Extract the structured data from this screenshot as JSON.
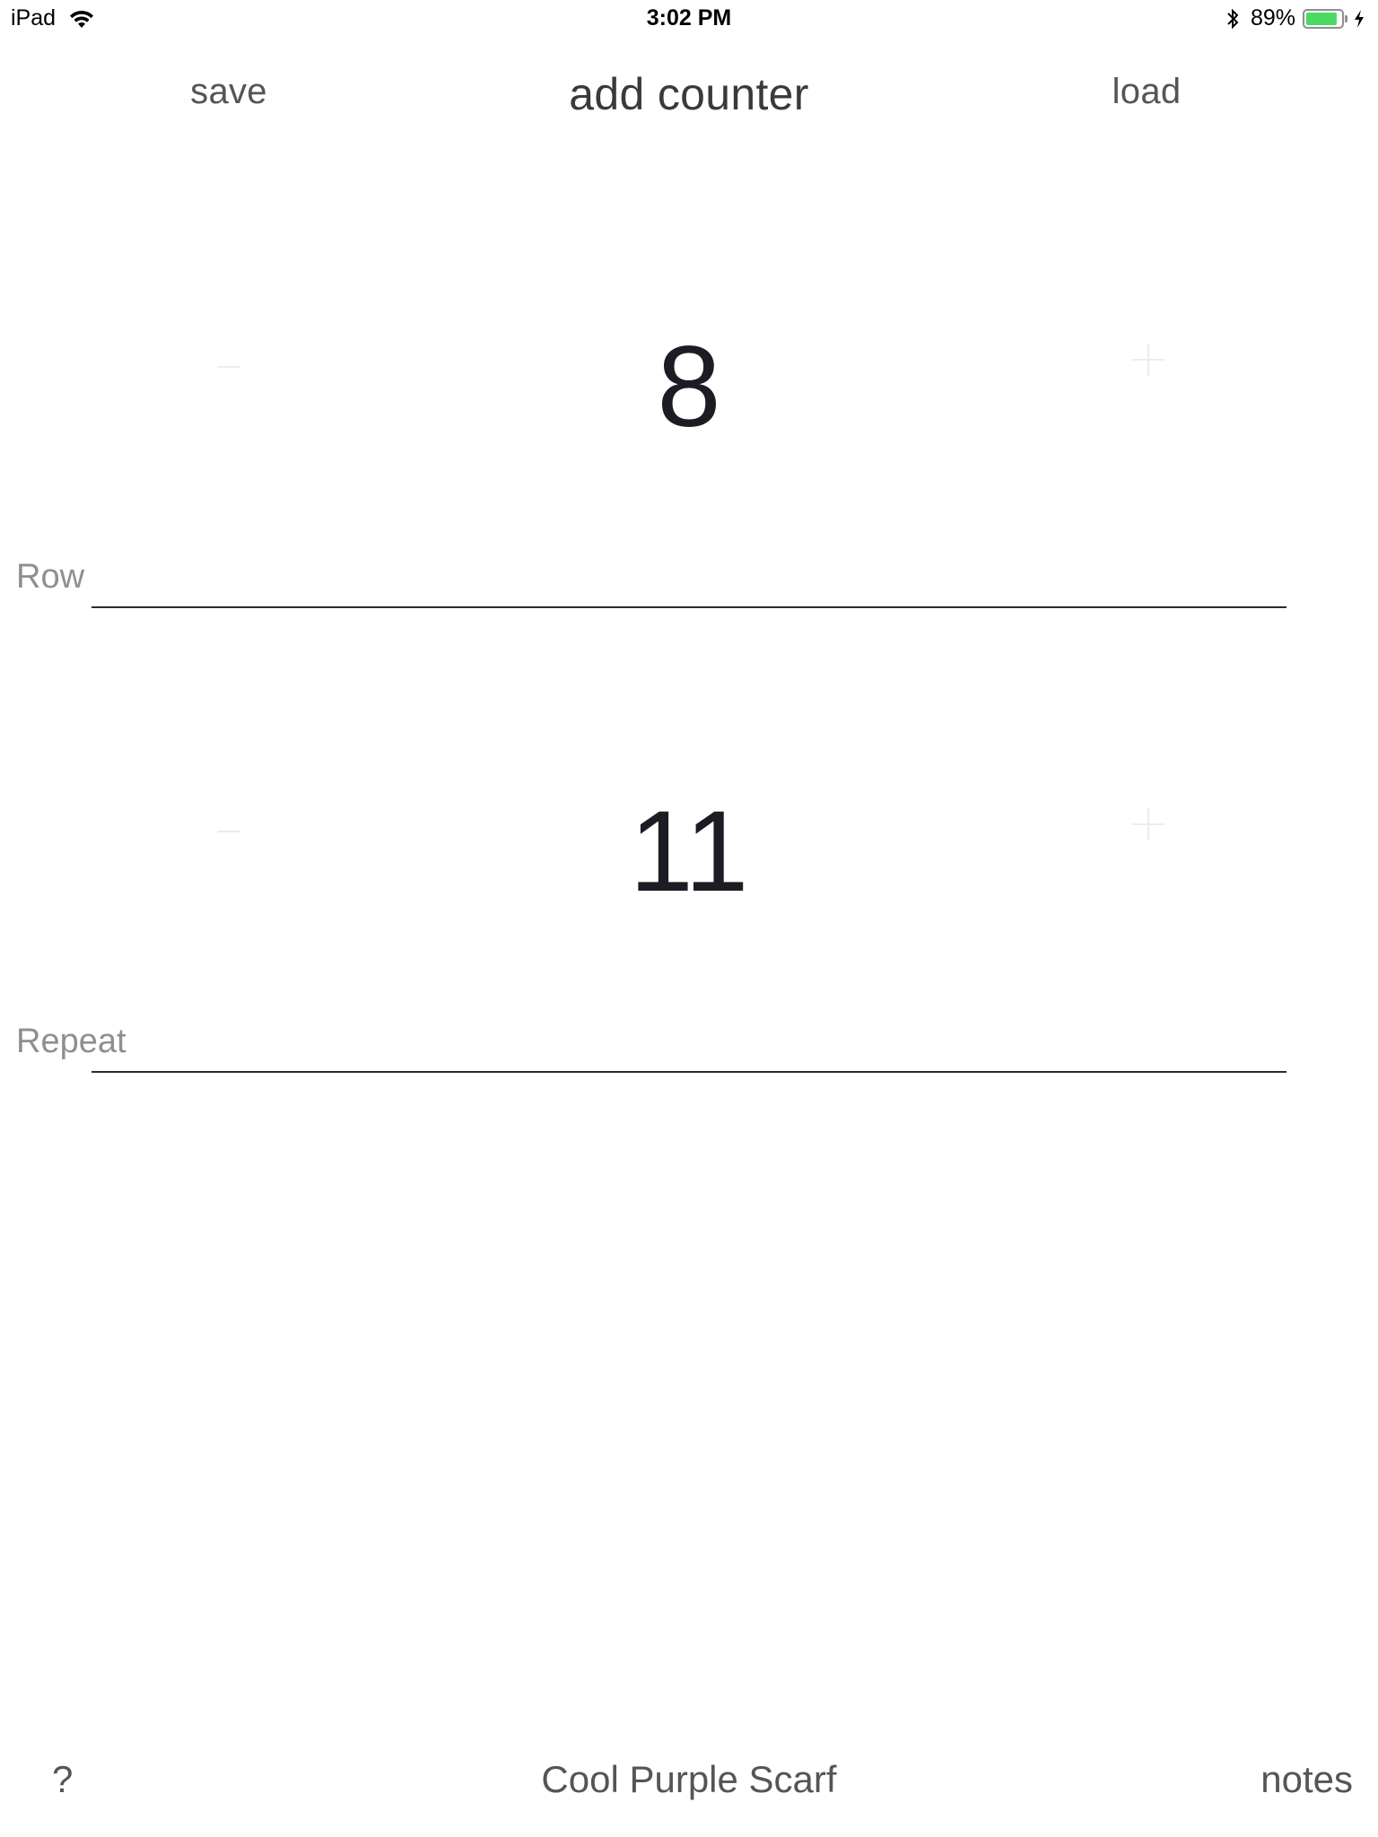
{
  "status_bar": {
    "device": "iPad",
    "time": "3:02 PM",
    "battery_percent_label": "89%",
    "battery_level": 0.89,
    "wifi_icon": "wifi-icon",
    "bluetooth_icon": "bluetooth-icon",
    "charging_icon": "charging-bolt-icon",
    "battery_color": "#4cd964"
  },
  "toolbar": {
    "save_label": "save",
    "title_label": "add counter",
    "load_label": "load"
  },
  "counters": [
    {
      "label": "Row",
      "value": "8"
    },
    {
      "label": "Repeat",
      "value": "11"
    }
  ],
  "bottom_bar": {
    "help_label": "?",
    "project_name": "Cool Purple Scarf",
    "notes_label": "notes"
  }
}
